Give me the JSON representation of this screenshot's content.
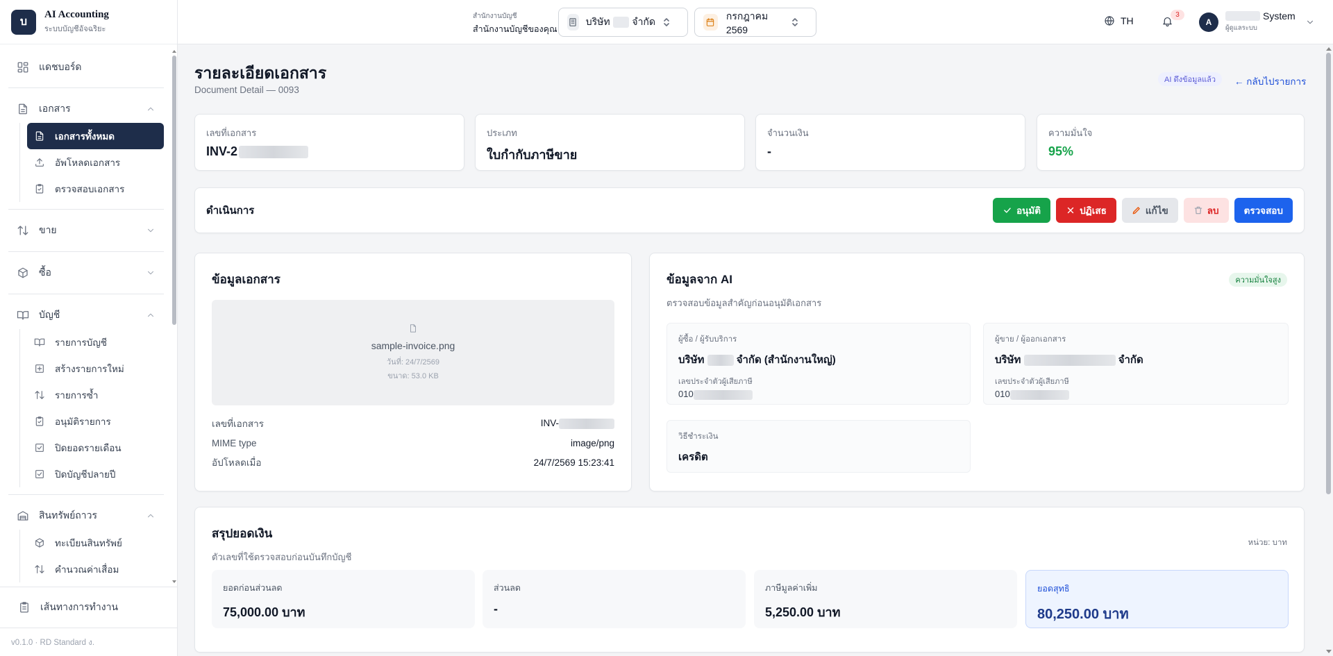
{
  "brand": {
    "logo_letter": "บ",
    "name": "AI Accounting",
    "subtitle": "ระบบบัญชีอัจฉริยะ"
  },
  "sidebar": {
    "dashboard": "แดชบอร์ด",
    "documents": {
      "label": "เอกสาร",
      "items": [
        {
          "label": "เอกสารทั้งหมด",
          "icon": "file-text-icon",
          "active": true
        },
        {
          "label": "อัพโหลดเอกสาร",
          "icon": "upload-icon"
        },
        {
          "label": "ตรวจสอบเอกสาร",
          "icon": "clipboard-check-icon"
        }
      ]
    },
    "sales": "ขาย",
    "purchase": "ซื้อ",
    "accounting": {
      "label": "บัญชี",
      "items": [
        {
          "label": "รายการบัญชี",
          "icon": "book-icon"
        },
        {
          "label": "สร้างรายการใหม่",
          "icon": "plus-square-icon"
        },
        {
          "label": "รายการซ้ำ",
          "icon": "arrows-updown-icon"
        },
        {
          "label": "อนุมัติรายการ",
          "icon": "clipboard-check-icon"
        },
        {
          "label": "ปิดยอดรายเดือน",
          "icon": "check-square-icon"
        },
        {
          "label": "ปิดบัญชีปลายปี",
          "icon": "check-square-icon"
        }
      ]
    },
    "assets": {
      "label": "สินทรัพย์ถาวร",
      "items": [
        {
          "label": "ทะเบียนสินทรัพย์",
          "icon": "box-icon"
        },
        {
          "label": "คำนวณค่าเสื่อม",
          "icon": "arrows-updown-icon"
        }
      ]
    },
    "workflow": "เส้นทางการทำงาน",
    "version": "v0.1.0 · RD Standard ง."
  },
  "header": {
    "office_label": "สำนักงานบัญชี",
    "office_name": "สำนักงานบัญชีของคุณ",
    "company_prefix": "บริษัท",
    "company_suffix": "จำกัด",
    "month": "กรกฎาคม 2569",
    "lang": "TH",
    "notif_count": "3",
    "avatar": "A",
    "user_name": "System",
    "user_role": "ผู้ดูแลระบบ"
  },
  "page": {
    "title": "รายละเอียดเอกสาร",
    "subtitle": "Document Detail — 0093",
    "ai_badge": "AI ดึงข้อมูลแล้ว",
    "back": "← กลับไปรายการ"
  },
  "stats": [
    {
      "label": "เลขที่เอกสาร",
      "value": "INV-2"
    },
    {
      "label": "ประเภท",
      "value": "ใบกำกับภาษีขาย"
    },
    {
      "label": "จำนวนเงิน",
      "value": "-"
    },
    {
      "label": "ความมั่นใจ",
      "value": "95%",
      "color": "#16a34a"
    }
  ],
  "actions": {
    "title": "ดำเนินการ",
    "approve": "อนุมัติ",
    "reject": "ปฏิเสธ",
    "edit": "แก้ไข",
    "delete": "ลบ",
    "verify": "ตรวจสอบ"
  },
  "doc": {
    "title": "ข้อมูลเอกสาร",
    "file_name": "sample-invoice.png",
    "file_date": "วันที่: 24/7/2569",
    "file_size": "ขนาด: 53.0 KB",
    "rows": [
      {
        "k": "เลขที่เอกสาร",
        "v": "INV-"
      },
      {
        "k": "MIME type",
        "v": "image/png"
      },
      {
        "k": "อัปโหลดเมื่อ",
        "v": "24/7/2569 15:23:41"
      }
    ]
  },
  "ai": {
    "title": "ข้อมูลจาก AI",
    "subtitle": "ตรวจสอบข้อมูลสำคัญก่อนอนุมัติเอกสาร",
    "confidence_badge": "ความมั่นใจสูง",
    "buyer": {
      "label": "ผู้ซื้อ / ผู้รับบริการ",
      "prefix": "บริษัท",
      "suffix": "จำกัด (สำนักงานใหญ่)",
      "tax_label": "เลขประจำตัวผู้เสียภาษี",
      "tax_prefix": "010"
    },
    "seller": {
      "label": "ผู้ขาย / ผู้ออกเอกสาร",
      "prefix": "บริษัท",
      "suffix": "จำกัด",
      "tax_label": "เลขประจำตัวผู้เสียภาษี",
      "tax_prefix": "010"
    },
    "payment": {
      "label": "วิธีชำระเงิน",
      "value": "เครดิต"
    }
  },
  "summary": {
    "title": "สรุปยอดเงิน",
    "subtitle": "ตัวเลขที่ใช้ตรวจสอบก่อนบันทึกบัญชี",
    "unit": "หน่วย: บาท",
    "boxes": [
      {
        "label": "ยอดก่อนส่วนลด",
        "value": "75,000.00 บาท"
      },
      {
        "label": "ส่วนลด",
        "value": "-"
      },
      {
        "label": "ภาษีมูลค่าเพิ่ม",
        "value": "5,250.00 บาท"
      },
      {
        "label": "ยอดสุทธิ",
        "value": "80,250.00 บาท"
      }
    ]
  }
}
